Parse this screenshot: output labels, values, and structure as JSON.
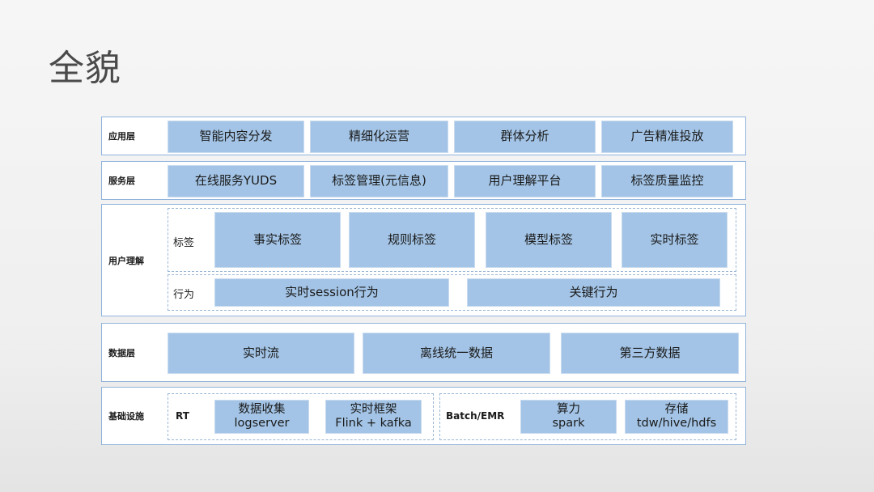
{
  "title": "全貌",
  "layers": {
    "app": {
      "label": "应用层",
      "boxes": [
        "智能内容分发",
        "精细化运营",
        "群体分析",
        "广告精准投放"
      ]
    },
    "service": {
      "label": "服务层",
      "boxes": [
        "在线服务YUDS",
        "标签管理(元信息)",
        "用户理解平台",
        "标签质量监控"
      ]
    },
    "user": {
      "label": "用户理解",
      "tags_label": "标签",
      "tags": [
        "事实标签",
        "规则标签",
        "模型标签",
        "实时标签"
      ],
      "behavior_label": "行为",
      "behaviors": [
        "实时session行为",
        "关键行为"
      ]
    },
    "data": {
      "label": "数据层",
      "boxes": [
        "实时流",
        "离线统一数据",
        "第三方数据"
      ]
    },
    "infra": {
      "label": "基础设施",
      "rt_label": "RT",
      "rt_boxes": [
        {
          "line1": "数据收集",
          "line2": "logserver"
        },
        {
          "line1": "实时框架",
          "line2": "Flink + kafka"
        }
      ],
      "batch_label": "Batch/EMR",
      "batch_boxes": [
        {
          "line1": "算力",
          "line2": "spark"
        },
        {
          "line1": "存储",
          "line2": "tdw/hive/hdfs"
        }
      ]
    }
  }
}
